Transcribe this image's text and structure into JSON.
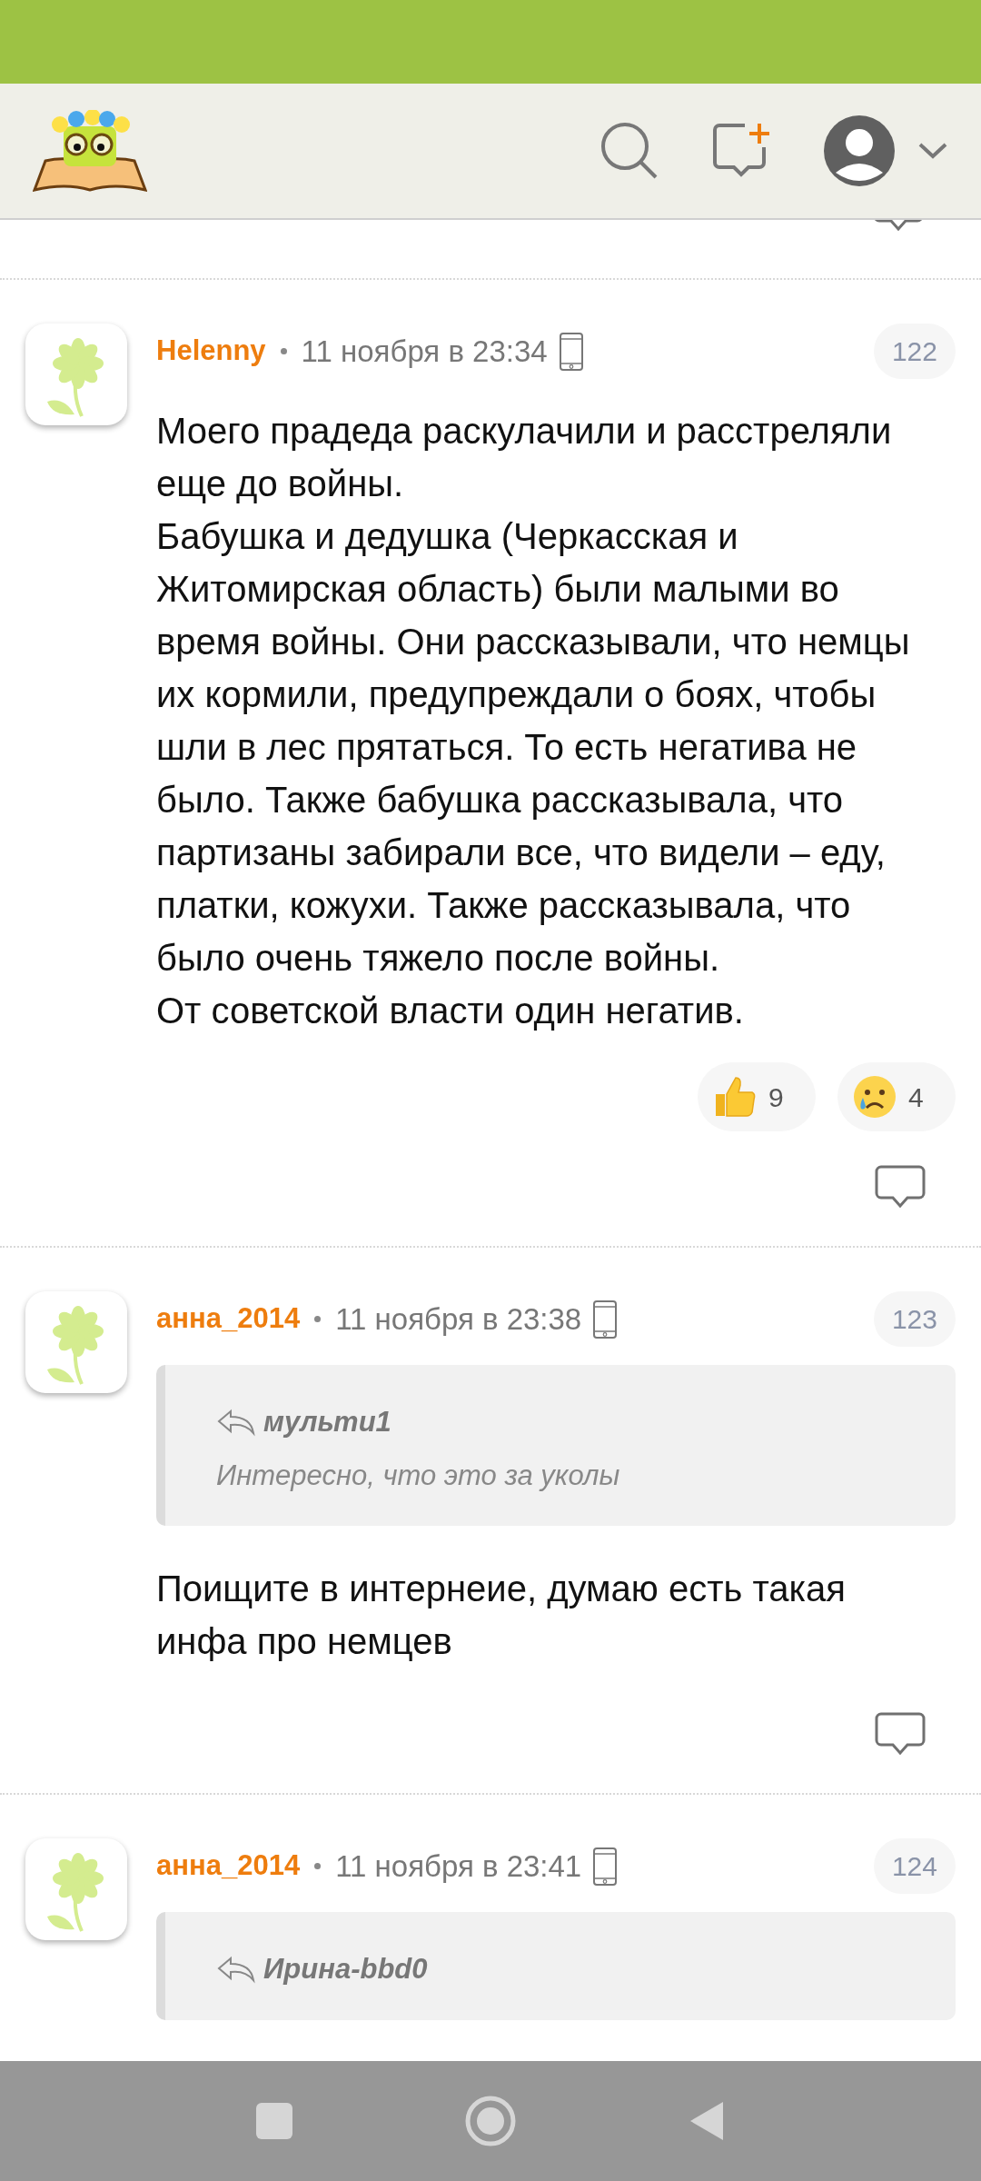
{
  "comments": [
    {
      "author": "Helenny",
      "date": "11 ноября в 23:34",
      "number": "122",
      "body": [
        "Моего прадеда раскулачили и расстреляли еще до войны.",
        "Бабушка и дедушка (Черкасская и Житомирская область) были малыми во время войны. Они рассказывали, что немцы их кормили, предупреждали о боях, чтобы шли в лес прятаться. То есть негатива не было. Также бабушка рассказывала, что партизаны забирали все, что видели – еду, платки, кожухи. Также рассказывала, что было очень тяжело после войны.",
        "От советской власти один негатив."
      ],
      "reactions": [
        {
          "kind": "like",
          "count": "9"
        },
        {
          "kind": "cry",
          "count": "4"
        }
      ]
    },
    {
      "author": "анна_2014",
      "date": "11 ноября в 23:38",
      "number": "123",
      "quote": {
        "author": "мульти1",
        "text": "Интересно, что это за уколы"
      },
      "body": [
        "Поищите в интернеие, думаю есть такая инфа про немцев"
      ]
    },
    {
      "author": "анна_2014",
      "date": "11 ноября в 23:41",
      "number": "124",
      "quote": {
        "author": "Ирина-bbd0"
      }
    }
  ]
}
